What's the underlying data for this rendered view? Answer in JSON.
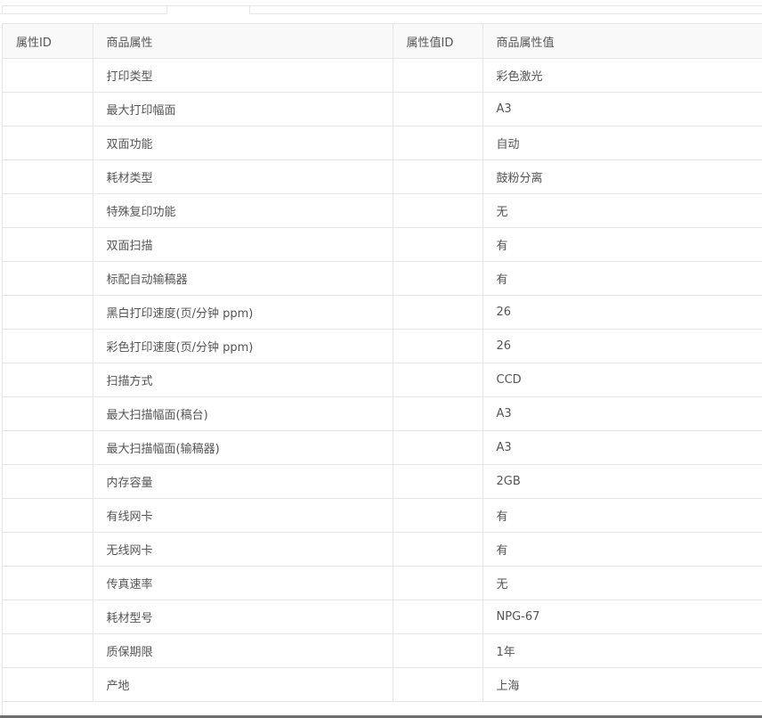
{
  "table": {
    "headers": [
      "属性ID",
      "商品属性",
      "属性值ID",
      "商品属性值"
    ],
    "rows": [
      {
        "attr_id": "",
        "attr": "打印类型",
        "value_id": "",
        "value": "彩色激光"
      },
      {
        "attr_id": "",
        "attr": "最大打印幅面",
        "value_id": "",
        "value": "A3"
      },
      {
        "attr_id": "",
        "attr": "双面功能",
        "value_id": "",
        "value": "自动"
      },
      {
        "attr_id": "",
        "attr": "耗材类型",
        "value_id": "",
        "value": "鼓粉分离"
      },
      {
        "attr_id": "",
        "attr": "特殊复印功能",
        "value_id": "",
        "value": "无"
      },
      {
        "attr_id": "",
        "attr": "双面扫描",
        "value_id": "",
        "value": "有"
      },
      {
        "attr_id": "",
        "attr": "标配自动输稿器",
        "value_id": "",
        "value": "有"
      },
      {
        "attr_id": "",
        "attr": "黑白打印速度(页/分钟 ppm)",
        "value_id": "",
        "value": "26"
      },
      {
        "attr_id": "",
        "attr": "彩色打印速度(页/分钟 ppm)",
        "value_id": "",
        "value": "26"
      },
      {
        "attr_id": "",
        "attr": "扫描方式",
        "value_id": "",
        "value": "CCD"
      },
      {
        "attr_id": "",
        "attr": "最大扫描幅面(稿台)",
        "value_id": "",
        "value": "A3"
      },
      {
        "attr_id": "",
        "attr": "最大扫描幅面(输稿器)",
        "value_id": "",
        "value": "A3"
      },
      {
        "attr_id": "",
        "attr": "内存容量",
        "value_id": "",
        "value": "2GB"
      },
      {
        "attr_id": "",
        "attr": "有线网卡",
        "value_id": "",
        "value": "有"
      },
      {
        "attr_id": "",
        "attr": "无线网卡",
        "value_id": "",
        "value": "有"
      },
      {
        "attr_id": "",
        "attr": "传真速率",
        "value_id": "",
        "value": "无"
      },
      {
        "attr_id": "",
        "attr": "耗材型号",
        "value_id": "",
        "value": "NPG-67"
      },
      {
        "attr_id": "",
        "attr": "质保期限",
        "value_id": "",
        "value": "1年"
      },
      {
        "attr_id": "",
        "attr": "产地",
        "value_id": "",
        "value": "上海"
      }
    ]
  },
  "colors": {
    "border": "#e6e6e6",
    "header_bg": "#f9f9f9",
    "text": "#555555"
  }
}
